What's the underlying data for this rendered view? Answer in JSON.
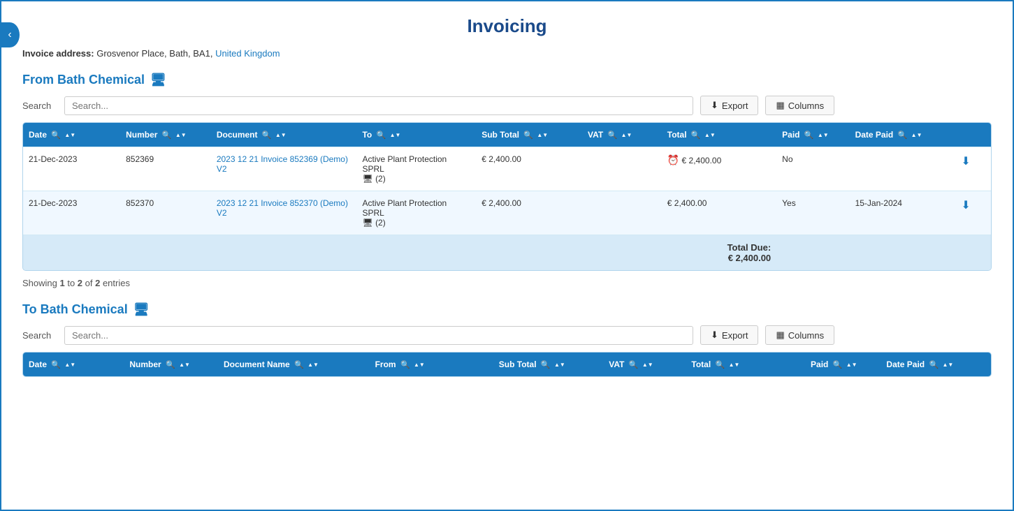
{
  "page": {
    "title": "Invoicing",
    "back_button_label": "‹",
    "invoice_address_label": "Invoice address:",
    "invoice_address_value": "Grosvenor Place, Bath, BA1,",
    "invoice_address_link": "United Kingdom"
  },
  "from_section": {
    "title": "From Bath Chemical",
    "monitor_icon": "🖥",
    "search_label": "Search",
    "search_placeholder": "Search...",
    "export_label": "Export",
    "columns_label": "Columns",
    "showing_text": "Showing 1 to 2 of 2 entries",
    "showing_highlighted": [
      "1",
      "2",
      "2"
    ],
    "columns": [
      {
        "label": "Date"
      },
      {
        "label": "Number"
      },
      {
        "label": "Document"
      },
      {
        "label": "To"
      },
      {
        "label": "Sub Total"
      },
      {
        "label": "VAT"
      },
      {
        "label": "Total"
      },
      {
        "label": "Paid"
      },
      {
        "label": "Date Paid"
      },
      {
        "label": ""
      }
    ],
    "rows": [
      {
        "date": "21-Dec-2023",
        "number": "852369",
        "document": "2023 12 21 Invoice 852369 (Demo) V2",
        "to": "Active Plant Protection SPRL",
        "to_sub": "(2)",
        "subtotal": "€ 2,400.00",
        "vat": "",
        "total_icon": "clock",
        "total": "€ 2,400.00",
        "paid": "No",
        "date_paid": "",
        "download": true
      },
      {
        "date": "21-Dec-2023",
        "number": "852370",
        "document": "2023 12 21 Invoice 852370 (Demo) V2",
        "to": "Active Plant Protection SPRL",
        "to_sub": "(2)",
        "subtotal": "€ 2,400.00",
        "vat": "",
        "total_icon": "",
        "total": "€ 2,400.00",
        "paid": "Yes",
        "date_paid": "15-Jan-2024",
        "download": true
      }
    ],
    "total_due_label": "Total Due:",
    "total_due_value": "€ 2,400.00"
  },
  "to_section": {
    "title": "To Bath Chemical",
    "monitor_icon": "🖥",
    "search_label": "Search",
    "search_placeholder": "Search...",
    "export_label": "Export",
    "columns_label": "Columns",
    "columns": [
      {
        "label": "Date"
      },
      {
        "label": "Number"
      },
      {
        "label": "Document Name"
      },
      {
        "label": "From"
      },
      {
        "label": "Sub Total"
      },
      {
        "label": "VAT"
      },
      {
        "label": "Total"
      },
      {
        "label": "Paid"
      },
      {
        "label": "Date Paid"
      }
    ]
  }
}
